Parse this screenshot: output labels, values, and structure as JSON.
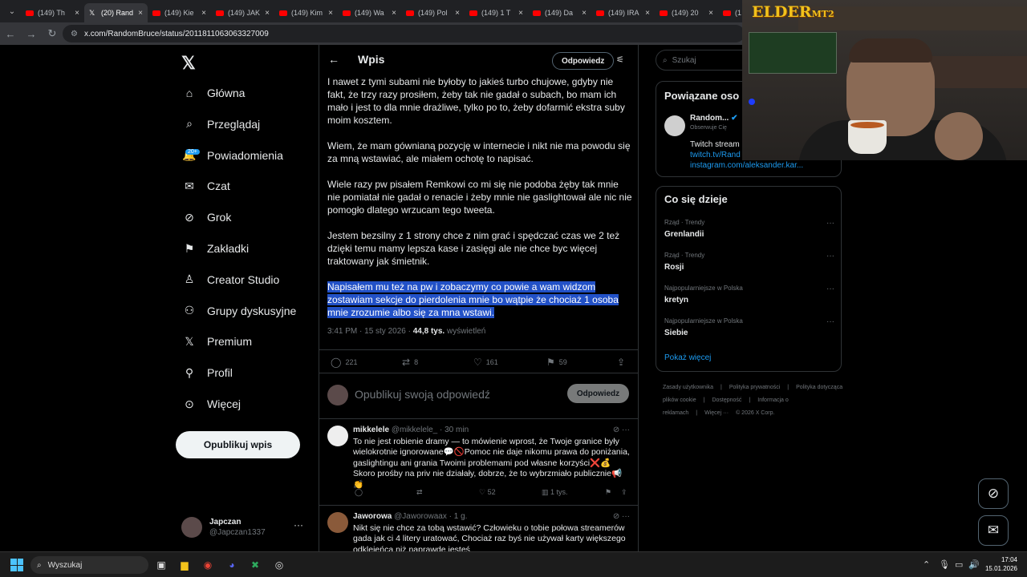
{
  "browser": {
    "tabs": [
      {
        "title": "(149) Th",
        "type": "youtube"
      },
      {
        "title": "(20) Rand",
        "type": "x",
        "active": true
      },
      {
        "title": "(149) Kie",
        "type": "youtube"
      },
      {
        "title": "(149) JAK",
        "type": "youtube"
      },
      {
        "title": "(149) Kim",
        "type": "youtube"
      },
      {
        "title": "(149) Wa",
        "type": "youtube"
      },
      {
        "title": "(149) Pol",
        "type": "youtube"
      },
      {
        "title": "(149) 1 T",
        "type": "youtube"
      },
      {
        "title": "(149) Da",
        "type": "youtube"
      },
      {
        "title": "(149) IRA",
        "type": "youtube"
      },
      {
        "title": "(149) 20",
        "type": "youtube"
      },
      {
        "title": "(1",
        "type": "youtube"
      }
    ],
    "url": "x.com/RandomBruce/status/2011811063063327009"
  },
  "sidebar": {
    "items": [
      {
        "label": "Główna",
        "icon": "home-icon"
      },
      {
        "label": "Przeglądaj",
        "icon": "search-icon"
      },
      {
        "label": "Powiadomienia",
        "icon": "bell-icon",
        "badge": "20+"
      },
      {
        "label": "Czat",
        "icon": "mail-icon"
      },
      {
        "label": "Grok",
        "icon": "grok-icon"
      },
      {
        "label": "Zakładki",
        "icon": "bookmark-icon"
      },
      {
        "label": "Creator Studio",
        "icon": "creator-icon"
      },
      {
        "label": "Grupy dyskusyjne",
        "icon": "people-icon"
      },
      {
        "label": "Premium",
        "icon": "x-icon"
      },
      {
        "label": "Profil",
        "icon": "person-icon"
      },
      {
        "label": "Więcej",
        "icon": "more-icon"
      }
    ],
    "post_button": "Opublikuj wpis",
    "account": {
      "name": "Japczan",
      "handle": "@Japczan1337"
    }
  },
  "post": {
    "header_title": "Wpis",
    "reply_button": "Odpowiedz",
    "paragraphs": [
      "I nawet z tymi subami nie byłoby to jakieś turbo chujowe, gdyby nie fakt, że trzy razy prosiłem, żeby tak nie gadał o subach, bo mam ich mało i jest to dla mnie drażliwe, tylko po to, żeby dofarmić ekstra suby moim kosztem.",
      "Wiem, że mam gównianą pozycję w internecie i nikt nie ma powodu się za mną wstawiać, ale miałem ochotę to napisać.",
      "Wiele razy pw pisałem Remkowi co mi się nie podoba żęby tak mnie nie pomiatał nie gadał o renacie i żeby mnie nie gaslightował ale nic nie pomogło dlatego wrzucam tego tweeta.",
      "Jestem bezsilny z 1 strony chce z nim grać i spędczać czas we 2 też dzięki temu mamy lepsza kase i zasięgi ale nie chce byc więcej traktowany jak śmietnik.",
      "Napisałem mu też na pw i zobaczymy co powie a wam widzom zostawiam sekcje do pierdolenia mnie bo wątpie że chociaż 1 osoba mnie zrozumie albo się za mna wstawi."
    ],
    "meta": {
      "time": "3:41 PM · 15 sty 2026 · ",
      "views": "44,8 tys.",
      "views_label": " wyświetleń"
    },
    "stats": {
      "replies": "221",
      "reposts": "8",
      "likes": "161",
      "bookmarks": "59"
    },
    "compose_placeholder": "Opublikuj swoją odpowiedź",
    "compose_button": "Odpowiedz"
  },
  "replies": [
    {
      "name": "mikkelele",
      "handle": "@mikkelele_",
      "time": " · 30 min",
      "text": "To nie jest robienie dramy — to mówienie wprost, że Twoje granice były wielokrotnie ignorowane💬🚫Pomoc nie daje nikomu prawa do poniżania, gaslightingu ani grania Twoimi problemami pod własne korzyści❌💰Skoro prośby na priv nie działały, dobrze, że to wybrzmiało publicznie📢👏",
      "likes": "52",
      "views": "1 tys."
    },
    {
      "name": "Jaworowa",
      "handle": "@Jaworowaax",
      "time": " · 1 g.",
      "text": "Nikt się nie chce za tobą wstawić? Człowieku o tobie połowa streamerów gada jak ci 4 litery uratować, Chociaż raz byś nie używał karty większego odklejeńca niż naprawde jesteś"
    }
  ],
  "right": {
    "search_placeholder": "Szukaj",
    "related_title": "Powiązane oso",
    "related_user": {
      "name": "Random...",
      "follows_you": "Obserwuje Cię",
      "bio": "Twitch stream",
      "link1": "twitch.tv/Rand",
      "link2": "instagram.com/aleksander.kar..."
    },
    "trends_title": "Co się dzieje",
    "trends": [
      {
        "category": "Rząd · Trendy",
        "name": "Grenlandii"
      },
      {
        "category": "Rząd · Trendy",
        "name": "Rosji"
      },
      {
        "category": "Najpopularniejsze w Polska",
        "name": "kretyn"
      },
      {
        "category": "Najpopularniejsze w Polska",
        "name": "Siebie"
      }
    ],
    "show_more": "Pokaż więcej",
    "footer": [
      "Zasady użytkownika",
      "|",
      "Polityka prywatności",
      "|",
      "Polityka dotycząca plików cookie",
      "|",
      "Dostępność",
      "|",
      "Informacja o reklamach",
      "|",
      "Więcej ···",
      "© 2026 X Corp."
    ]
  },
  "overlay": {
    "brand": "ELDER",
    "brand_suffix": "MT2"
  },
  "taskbar": {
    "search_placeholder": "Wyszukaj",
    "time": "17:04",
    "date": "15.01.2026"
  }
}
